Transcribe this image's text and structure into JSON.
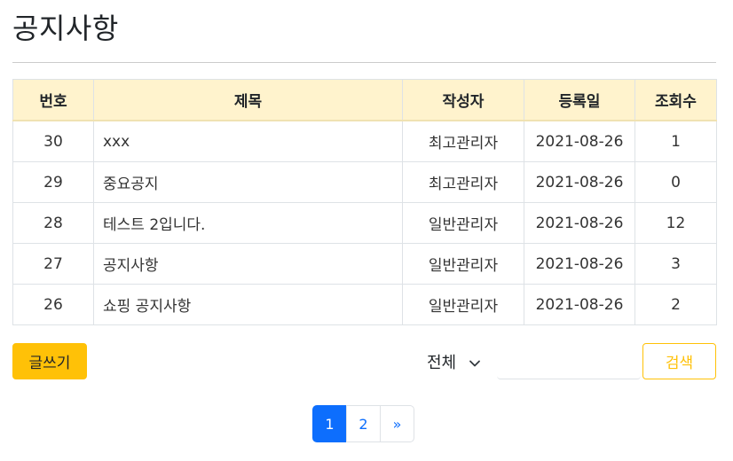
{
  "page": {
    "title": "공지사항"
  },
  "table": {
    "headers": {
      "no": "번호",
      "title": "제목",
      "author": "작성자",
      "date": "등록일",
      "views": "조회수"
    },
    "rows": [
      {
        "no": "30",
        "title": "xxx",
        "author": "최고관리자",
        "date": "2021-08-26",
        "views": "1"
      },
      {
        "no": "29",
        "title": "중요공지",
        "author": "최고관리자",
        "date": "2021-08-26",
        "views": "0"
      },
      {
        "no": "28",
        "title": "테스트 2입니다.",
        "author": "일반관리자",
        "date": "2021-08-26",
        "views": "12"
      },
      {
        "no": "27",
        "title": "공지사항",
        "author": "일반관리자",
        "date": "2021-08-26",
        "views": "3"
      },
      {
        "no": "26",
        "title": "쇼핑 공지사항",
        "author": "일반관리자",
        "date": "2021-08-26",
        "views": "2"
      }
    ]
  },
  "actions": {
    "write_label": "글쓰기",
    "search_type_selected": "전체",
    "search_value": "",
    "search_label": "검색"
  },
  "pagination": {
    "pages": [
      "1",
      "2"
    ],
    "current": "1",
    "next_label": "»"
  },
  "colors": {
    "header_background": "#fff3cd",
    "accent": "#ffc107",
    "page_active": "#0d6efd"
  },
  "icons": {
    "search_type_dropdown": "chevron-down-icon"
  }
}
